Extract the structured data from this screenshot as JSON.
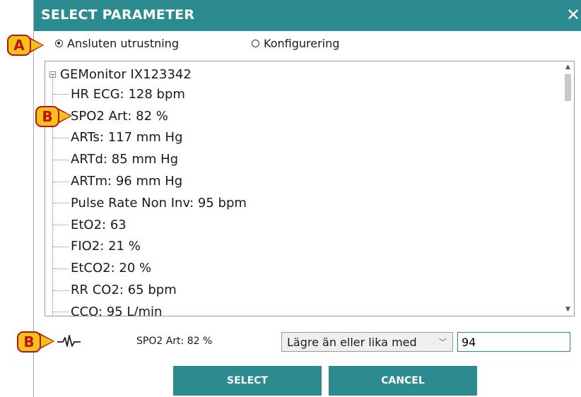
{
  "dialog": {
    "title": "SELECT PARAMETER",
    "close_glyph": "✕"
  },
  "radios": [
    {
      "label": "Ansluten utrustning",
      "checked": true
    },
    {
      "label": "Konfigurering",
      "checked": false
    }
  ],
  "tree": {
    "root": "GEMonitor IX123342",
    "items": [
      "HR ECG: 128 bpm",
      "SPO2 Art: 82 %",
      "ARTs: 117 mm Hg",
      "ARTd: 85 mm Hg",
      "ARTm: 96 mm Hg",
      "Pulse Rate Non Inv: 95 bpm",
      "EtO2: 63",
      "FIO2: 21 %",
      "EtCO2: 20 %",
      "RR CO2: 65 bpm",
      "CCO: 95 L/min"
    ]
  },
  "badges": {
    "a": "A",
    "b_list": "B",
    "b_bottom": "B"
  },
  "selection": {
    "label": "SPO2 Art: 82 %",
    "operator": "Lägre än eller lika med",
    "value": "94"
  },
  "buttons": {
    "select": "SELECT",
    "cancel": "CANCEL"
  },
  "colors": {
    "accent": "#2b8b8f",
    "badge_fill": "#f2c21c",
    "badge_stroke": "#c01010"
  },
  "icons": {
    "pulse": "pulse-waveform-icon",
    "expander": "tree-collapse-icon"
  }
}
